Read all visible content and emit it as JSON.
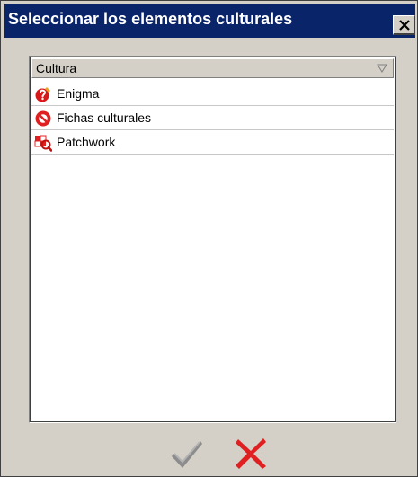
{
  "window": {
    "title": "Seleccionar los elementos culturales"
  },
  "list": {
    "column_header": "Cultura",
    "items": [
      {
        "label": "Enigma",
        "icon": "enigma-icon"
      },
      {
        "label": "Fichas culturales",
        "icon": "fichas-culturales-icon"
      },
      {
        "label": "Patchwork",
        "icon": "patchwork-icon"
      }
    ]
  },
  "actions": {
    "ok_icon": "checkmark-icon",
    "cancel_icon": "cancel-x-icon"
  },
  "colors": {
    "titlebar": "#0a246a",
    "window_bg": "#d4d0c8",
    "cancel_red": "#e02020",
    "ok_gray": "#8c8c8c"
  }
}
